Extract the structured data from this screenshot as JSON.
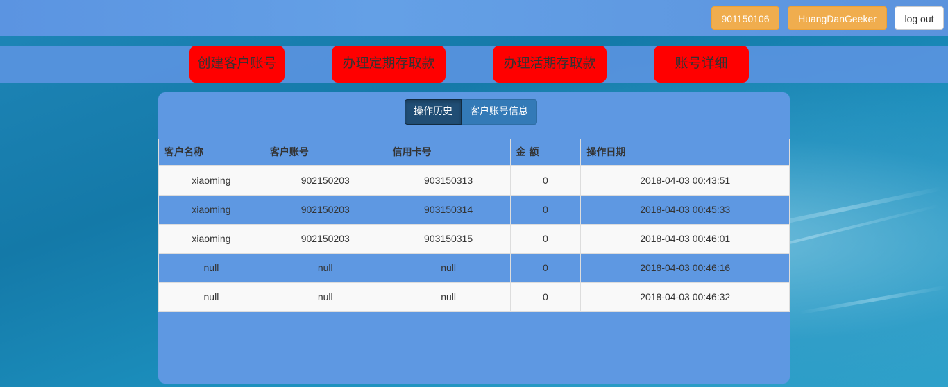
{
  "header": {
    "account_id": "901150106",
    "username": "HuangDanGeeker",
    "logout_label": "log out"
  },
  "actions": {
    "create_account": "创建客户账号",
    "fixed_deposit": "办理定期存取款",
    "current_deposit": "办理活期存取款",
    "account_details": "账号详细"
  },
  "tabs": {
    "history": "操作历史",
    "account_info": "客户账号信息"
  },
  "table": {
    "headers": [
      "客户名称",
      "客户账号",
      "信用卡号",
      "金 额",
      "操作日期"
    ],
    "rows": [
      [
        "xiaoming",
        "902150203",
        "903150313",
        "0",
        "2018-04-03 00:43:51"
      ],
      [
        "xiaoming",
        "902150203",
        "903150314",
        "0",
        "2018-04-03 00:45:33"
      ],
      [
        "xiaoming",
        "902150203",
        "903150315",
        "0",
        "2018-04-03 00:46:01"
      ],
      [
        "null",
        "null",
        "null",
        "0",
        "2018-04-03 00:46:16"
      ],
      [
        "null",
        "null",
        "null",
        "0",
        "2018-04-03 00:46:32"
      ]
    ]
  },
  "colors": {
    "navbar": "#5b94e1",
    "orange_button": "#f0ad4e",
    "action_button": "#ff0000",
    "panel": "#5e98e2",
    "tab_active": "#204d74",
    "tab_normal": "#337ab7"
  }
}
